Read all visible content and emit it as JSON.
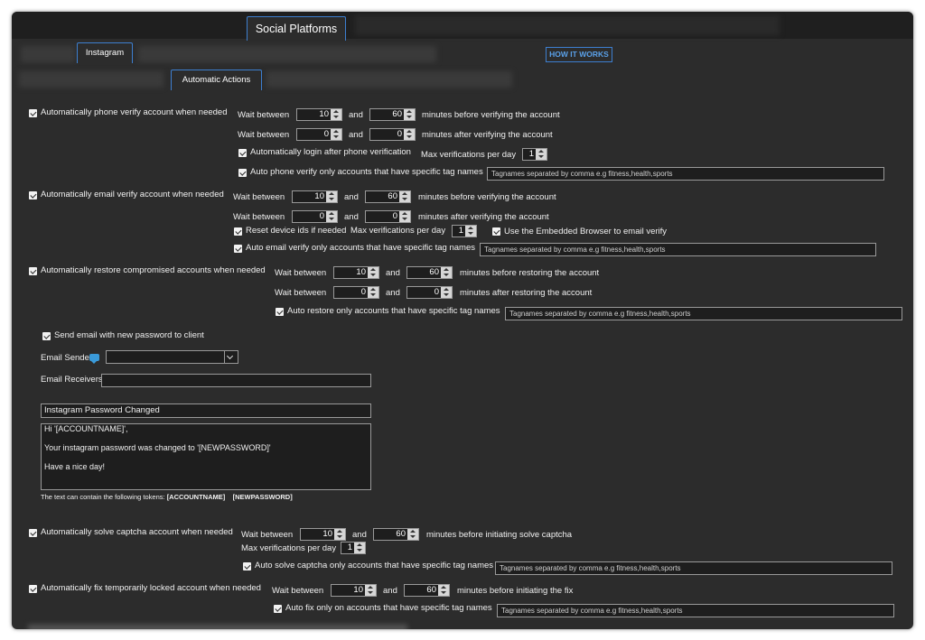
{
  "tabs": {
    "main": "Social Platforms",
    "sub": "Instagram",
    "sub2": "Automatic Actions",
    "how": "HOW IT WORKS"
  },
  "common": {
    "wait_between": "Wait between",
    "and": "and",
    "tag_placeholder": "Tagnames separated by comma e.g fitness,health,sports",
    "max_per_day": "Max verifications per day"
  },
  "phone": {
    "label": "Automatically phone verify account when needed",
    "r1_a": "10",
    "r1_b": "60",
    "r1_suffix": "minutes before verifying the account",
    "r2_a": "0",
    "r2_b": "0",
    "r2_suffix": "minutes after verifying the account",
    "login": "Automatically login after phone verification",
    "max": "1",
    "tags": "Auto phone verify only accounts that have specific tag names"
  },
  "email": {
    "label": "Automatically email verify account when needed",
    "r1_a": "10",
    "r1_b": "60",
    "r1_suffix": "minutes before verifying the account",
    "r2_a": "0",
    "r2_b": "0",
    "r2_suffix": "minutes after verifying the account",
    "reset": "Reset device ids if needed",
    "max": "1",
    "embedded": "Use the Embedded Browser to email verify",
    "tags": "Auto email verify only accounts that have specific tag names"
  },
  "restore": {
    "label": "Automatically restore compromised accounts when needed",
    "r1_a": "10",
    "r1_b": "60",
    "r1_suffix": "minutes before restoring the account",
    "r2_a": "0",
    "r2_b": "0",
    "r2_suffix": "minutes after restoring the account",
    "tags": "Auto restore only accounts that have specific tag names"
  },
  "mail": {
    "send": "Send email with new password to client",
    "sender": "Email Sender",
    "receivers": "Email Receivers",
    "subject": "Instagram Password Changed",
    "body_l1": "Hi '[ACCOUNTNAME]',",
    "body_l2": "Your instagram password was changed to '[NEWPASSWORD]'",
    "body_l3": "Have a nice day!",
    "tokens": "The text can contain the following tokens:",
    "tok1": "[ACCOUNTNAME]",
    "tok2": "[NEWPASSWORD]"
  },
  "captcha": {
    "label": "Automatically solve captcha account when needed",
    "r1_a": "10",
    "r1_b": "60",
    "r1_suffix": "minutes before initiating solve captcha",
    "max": "1",
    "tags": "Auto solve captcha only accounts that have specific tag names"
  },
  "locked": {
    "label": "Automatically fix temporarily locked account when needed",
    "r1_a": "10",
    "r1_b": "60",
    "r1_suffix": "minutes before initiating the fix",
    "tags": "Auto fix only on accounts that have specific tag names"
  }
}
